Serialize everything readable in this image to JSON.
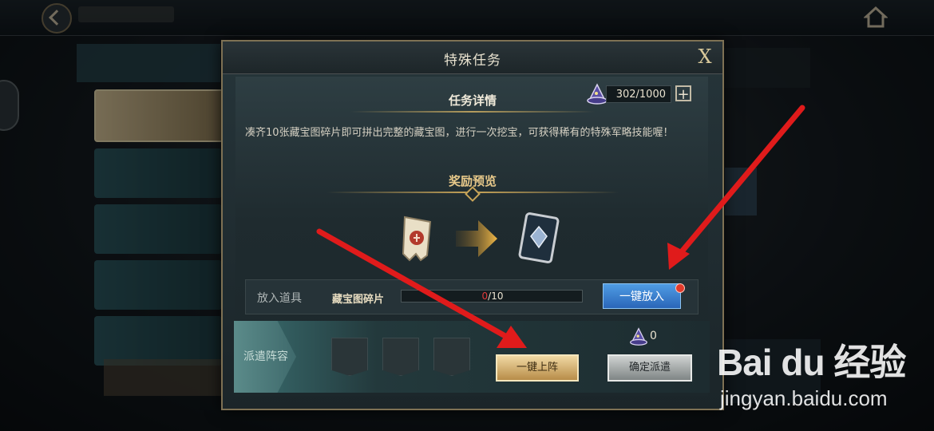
{
  "modal": {
    "title": "特殊任务",
    "close_label": "X",
    "detail_title": "任务详情",
    "counter": "302/1000",
    "plus_label": "+",
    "description": "凑齐10张藏宝图碎片即可拼出完整的藏宝图，进行一次挖宝，可获得稀有的特殊军略技能喔！",
    "reward_title": "奖励预览",
    "put_label": "放入道具",
    "item_name": "藏宝图碎片",
    "progress_current": "0",
    "progress_total": "/10",
    "progress_fraction": 0,
    "put_button": "一键放入",
    "dispatch_label": "派遣阵容",
    "cost_value": "0",
    "auto_deploy_button": "一键上阵",
    "confirm_button": "确定派遣"
  },
  "watermark": {
    "logo": "Bai du 经验",
    "url": "jingyan.baidu.com"
  },
  "colors": {
    "accent_gold": "#c9a558",
    "put_button_blue": "#3a7ccd",
    "arrow_red": "#e01b1b"
  }
}
